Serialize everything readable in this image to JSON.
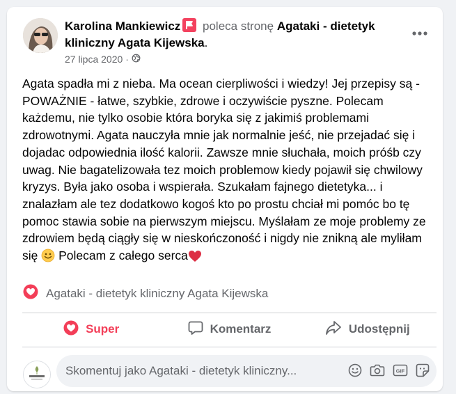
{
  "post": {
    "author": "Karolina Mankiewicz",
    "recommends_text": "poleca stronę",
    "page_name": "Agataki - dietetyk kliniczny Agata Kijewska",
    "page_name_suffix": ".",
    "date": "27 lipca 2020",
    "date_separator": "·",
    "body_main": "Agata spadła mi z nieba. Ma ocean cierpliwości i wiedzy! Jej przepisy są - POWAŻNIE - łatwe, szybkie, zdrowe i oczywiście pyszne. Polecam każdemu, nie tylko osobie która boryka się z jakimiś problemami zdrowotnymi. Agata nauczyła mnie jak normalnie jeść, nie przejadać się i dojadac odpowiednia ilość kalorii. Zawsze mnie słuchała, moich próśb czy uwag. Nie bagatelizowała tez moich problemow kiedy pojawił się chwilowy kryzys. Była jako osoba i wspierała. Szukałam fajnego dietetyka... i znalazłam ale tez dodatkowo kogoś kto po prostu chciał mi pomóc bo tę pomoc stawia sobie na pierwszym miejscu. Myślałam ze moje problemy ze zdrowiem będą ciągły się w nieskończoność i nigdy nie znikną ale myliłam się ",
    "body_after_smiley": " Polecam z całego serca",
    "tag_label": "Agataki - dietetyk kliniczny Agata Kijewska"
  },
  "actions": {
    "super": "Super",
    "comment": "Komentarz",
    "share": "Udostępnij"
  },
  "comment_box": {
    "placeholder": "Skomentuj jako Agataki - dietetyk kliniczny..."
  },
  "icons": {
    "recommend": "recommend-flag-icon",
    "privacy": "globe-icon",
    "more": "more-options-icon",
    "tag": "love-reaction-icon",
    "smiley": "smiley-emoji",
    "heart": "red-heart-emoji",
    "comment_tools": [
      "emoji-icon",
      "camera-icon",
      "gif-icon",
      "sticker-icon"
    ]
  },
  "colors": {
    "accent_super": "#f33e58",
    "recommend_badge": "#f3425f",
    "muted_text": "#65676b",
    "comment_box_bg": "#f0f2f5"
  }
}
